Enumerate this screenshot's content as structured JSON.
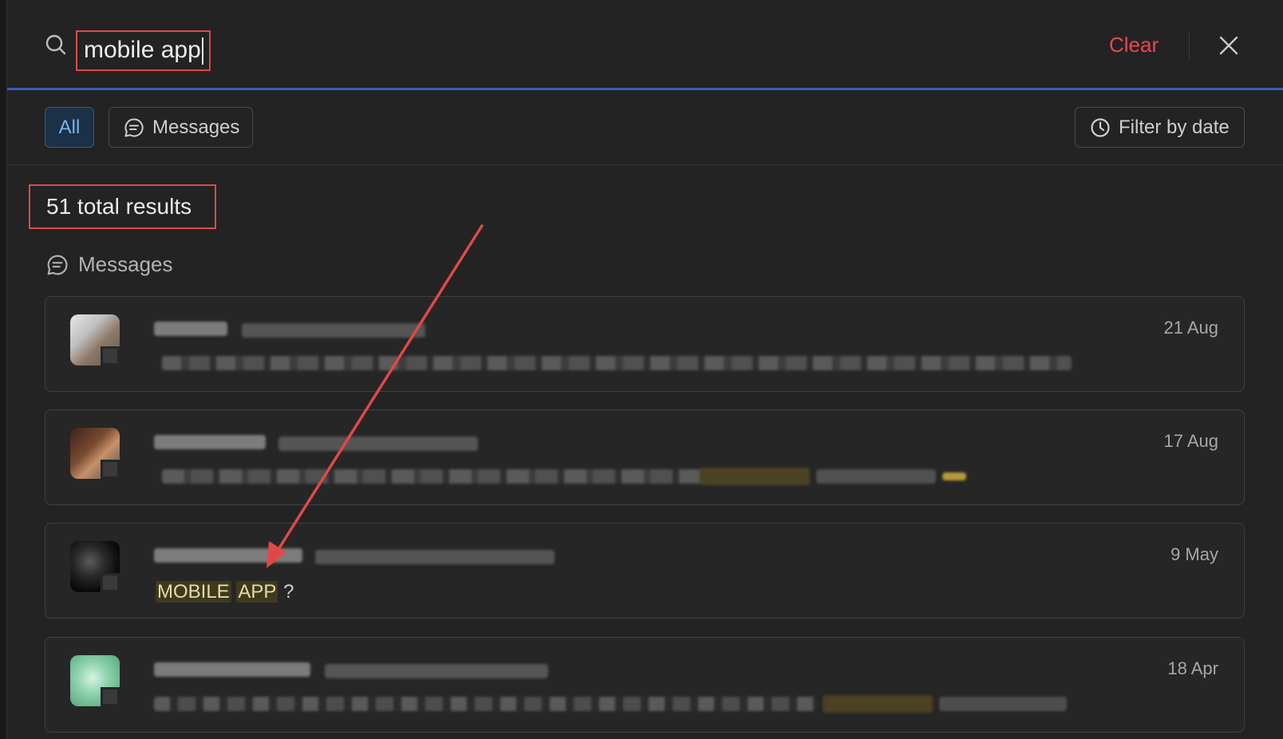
{
  "search": {
    "query": "mobile app",
    "clear_label": "Clear"
  },
  "filters": {
    "all_label": "All",
    "messages_label": "Messages",
    "filter_by_date_label": "Filter by date"
  },
  "results": {
    "total_label": "51 total results",
    "section_label": "Messages",
    "items": [
      {
        "date": "21 Aug"
      },
      {
        "date": "17 Aug"
      },
      {
        "date": "9 May",
        "match_1": "MOBILE",
        "match_2": "APP",
        "tail": " ?"
      },
      {
        "date": "18 Apr"
      }
    ]
  },
  "colors": {
    "accent_blue": "#78b4ee",
    "clear_red": "#e6484f",
    "highlight_bg": "#3f3a1e",
    "annotation_red": "#e04848"
  },
  "icons": [
    "search-icon",
    "close-icon",
    "chat-bubble-icon",
    "clock-icon"
  ]
}
